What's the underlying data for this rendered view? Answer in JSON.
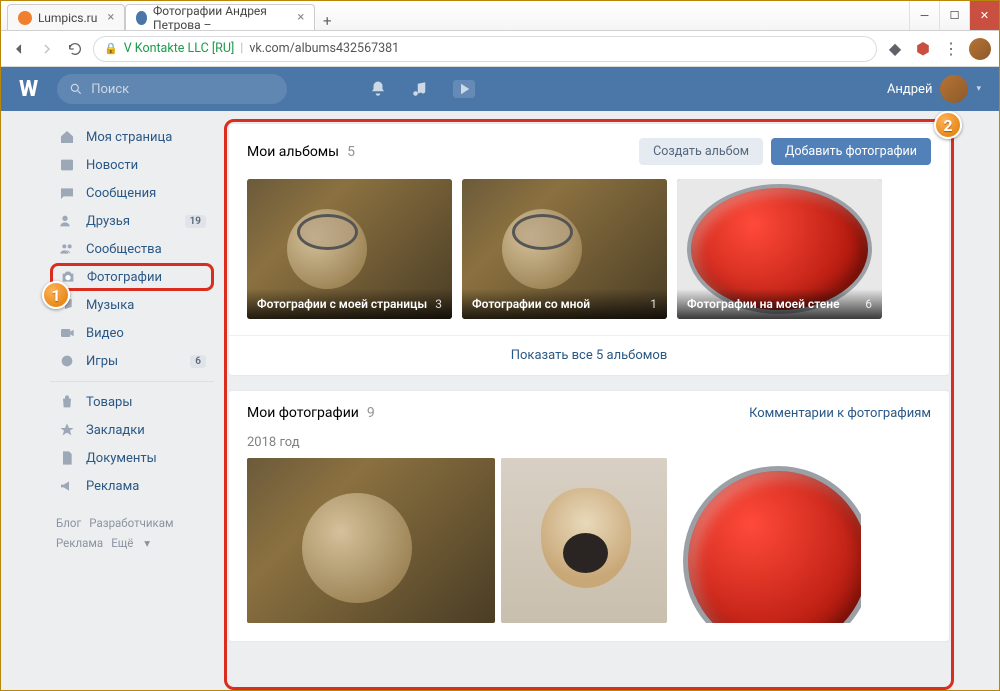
{
  "browser": {
    "tabs": [
      {
        "title": "Lumpics.ru",
        "favColor": "#f08030"
      },
      {
        "title": "Фотографии Андрея Петрова –",
        "favColor": "#4a76a8"
      }
    ],
    "url_org": "V Kontakte LLC [RU]",
    "url_path": "vk.com/albums432567381"
  },
  "header": {
    "search_placeholder": "Поиск",
    "username": "Андрей"
  },
  "sidebar": {
    "items": [
      {
        "label": "Моя страница"
      },
      {
        "label": "Новости"
      },
      {
        "label": "Сообщения"
      },
      {
        "label": "Друзья",
        "badge": "19"
      },
      {
        "label": "Сообщества"
      },
      {
        "label": "Фотографии"
      },
      {
        "label": "Музыка"
      },
      {
        "label": "Видео"
      },
      {
        "label": "Игры",
        "badge": "6"
      }
    ],
    "items2": [
      {
        "label": "Товары"
      },
      {
        "label": "Закладки"
      },
      {
        "label": "Документы"
      },
      {
        "label": "Реклама"
      }
    ],
    "foot": {
      "a": "Блог",
      "b": "Разработчикам",
      "c": "Реклама",
      "d": "Ещё"
    }
  },
  "albums": {
    "title": "Мои альбомы",
    "count": "5",
    "create_label": "Создать альбом",
    "add_label": "Добавить фотографии",
    "list": [
      {
        "title": "Фотографии с моей страницы",
        "count": "3"
      },
      {
        "title": "Фотографии со мной",
        "count": "1"
      },
      {
        "title": "Фотографии на моей стене",
        "count": "6"
      }
    ],
    "show_all": "Показать все 5 альбомов"
  },
  "photos": {
    "title": "Мои фотографии",
    "count": "9",
    "comments_link": "Комментарии к фотографиям",
    "year": "2018 год"
  },
  "callouts": {
    "c1": "1",
    "c2": "2"
  }
}
